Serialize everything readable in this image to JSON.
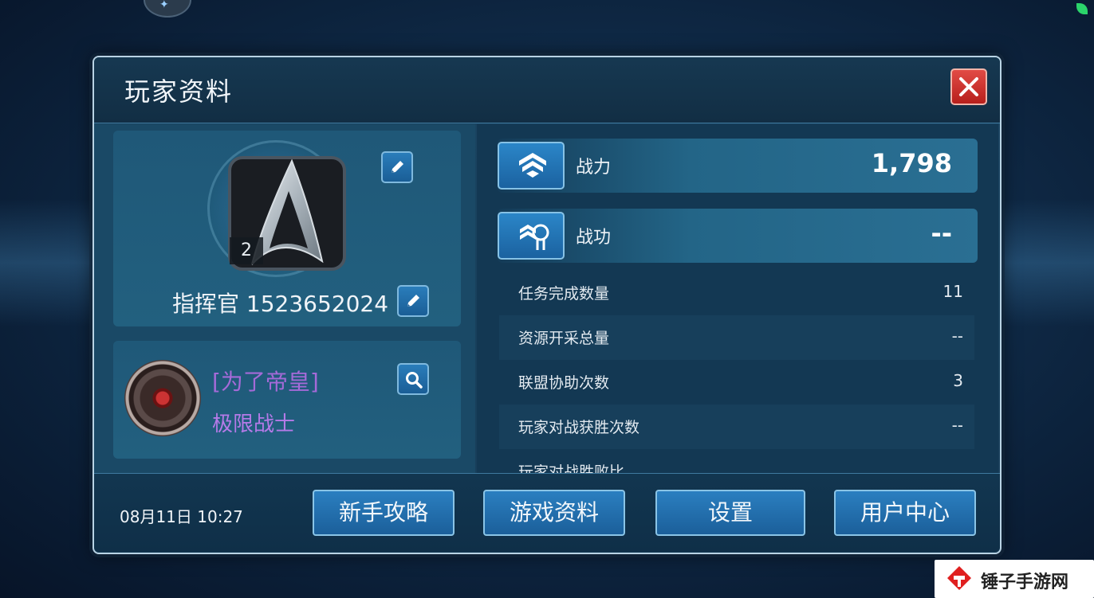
{
  "window": {
    "title": "玩家资料"
  },
  "profile": {
    "level": "2",
    "commander_name": "指挥官 1523652024"
  },
  "alliance": {
    "tag": "[为了帝皇]",
    "name": "极限战士"
  },
  "stats_main": [
    {
      "label": "战力",
      "value": "1,798",
      "icon": "power-icon"
    },
    {
      "label": "战功",
      "value": "--",
      "icon": "merit-icon"
    }
  ],
  "stats_list": [
    {
      "label": "任务完成数量",
      "value": "11"
    },
    {
      "label": "资源开采总量",
      "value": "--"
    },
    {
      "label": "联盟协助次数",
      "value": "3"
    },
    {
      "label": "玩家对战获胜次数",
      "value": "--"
    },
    {
      "label": "玩家对战胜败比",
      "value": ""
    }
  ],
  "footer": {
    "datetime": "08月11日 10:27",
    "buttons": [
      "新手攻略",
      "游戏资料",
      "设置",
      "用户中心"
    ]
  },
  "watermark": {
    "text": "锤子手游网"
  },
  "colors": {
    "accent": "#2b7fc0",
    "alliance": "#a56ad8",
    "close": "#d8332f"
  }
}
